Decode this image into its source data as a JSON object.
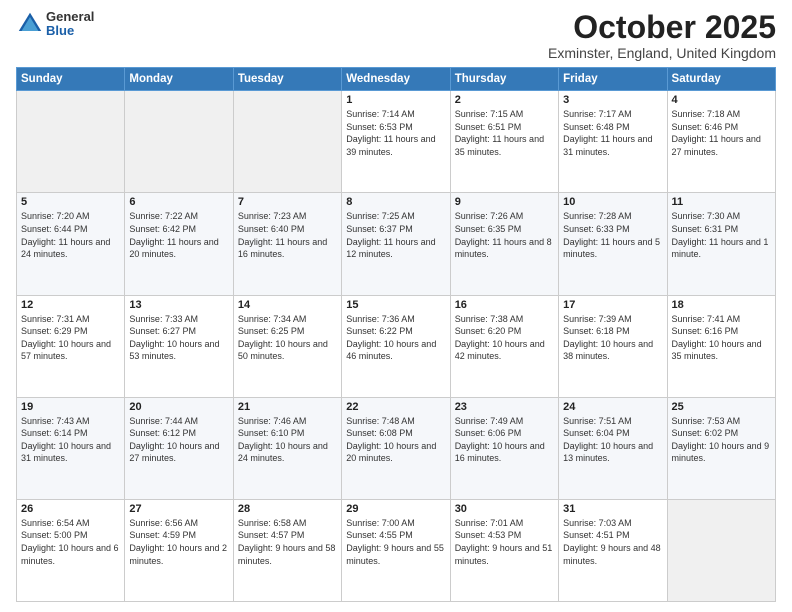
{
  "header": {
    "logo": {
      "general": "General",
      "blue": "Blue"
    },
    "title": "October 2025",
    "subtitle": "Exminster, England, United Kingdom"
  },
  "calendar": {
    "days_of_week": [
      "Sunday",
      "Monday",
      "Tuesday",
      "Wednesday",
      "Thursday",
      "Friday",
      "Saturday"
    ],
    "weeks": [
      [
        {
          "day": "",
          "data": ""
        },
        {
          "day": "",
          "data": ""
        },
        {
          "day": "",
          "data": ""
        },
        {
          "day": "1",
          "data": "Sunrise: 7:14 AM\nSunset: 6:53 PM\nDaylight: 11 hours and 39 minutes."
        },
        {
          "day": "2",
          "data": "Sunrise: 7:15 AM\nSunset: 6:51 PM\nDaylight: 11 hours and 35 minutes."
        },
        {
          "day": "3",
          "data": "Sunrise: 7:17 AM\nSunset: 6:48 PM\nDaylight: 11 hours and 31 minutes."
        },
        {
          "day": "4",
          "data": "Sunrise: 7:18 AM\nSunset: 6:46 PM\nDaylight: 11 hours and 27 minutes."
        }
      ],
      [
        {
          "day": "5",
          "data": "Sunrise: 7:20 AM\nSunset: 6:44 PM\nDaylight: 11 hours and 24 minutes."
        },
        {
          "day": "6",
          "data": "Sunrise: 7:22 AM\nSunset: 6:42 PM\nDaylight: 11 hours and 20 minutes."
        },
        {
          "day": "7",
          "data": "Sunrise: 7:23 AM\nSunset: 6:40 PM\nDaylight: 11 hours and 16 minutes."
        },
        {
          "day": "8",
          "data": "Sunrise: 7:25 AM\nSunset: 6:37 PM\nDaylight: 11 hours and 12 minutes."
        },
        {
          "day": "9",
          "data": "Sunrise: 7:26 AM\nSunset: 6:35 PM\nDaylight: 11 hours and 8 minutes."
        },
        {
          "day": "10",
          "data": "Sunrise: 7:28 AM\nSunset: 6:33 PM\nDaylight: 11 hours and 5 minutes."
        },
        {
          "day": "11",
          "data": "Sunrise: 7:30 AM\nSunset: 6:31 PM\nDaylight: 11 hours and 1 minute."
        }
      ],
      [
        {
          "day": "12",
          "data": "Sunrise: 7:31 AM\nSunset: 6:29 PM\nDaylight: 10 hours and 57 minutes."
        },
        {
          "day": "13",
          "data": "Sunrise: 7:33 AM\nSunset: 6:27 PM\nDaylight: 10 hours and 53 minutes."
        },
        {
          "day": "14",
          "data": "Sunrise: 7:34 AM\nSunset: 6:25 PM\nDaylight: 10 hours and 50 minutes."
        },
        {
          "day": "15",
          "data": "Sunrise: 7:36 AM\nSunset: 6:22 PM\nDaylight: 10 hours and 46 minutes."
        },
        {
          "day": "16",
          "data": "Sunrise: 7:38 AM\nSunset: 6:20 PM\nDaylight: 10 hours and 42 minutes."
        },
        {
          "day": "17",
          "data": "Sunrise: 7:39 AM\nSunset: 6:18 PM\nDaylight: 10 hours and 38 minutes."
        },
        {
          "day": "18",
          "data": "Sunrise: 7:41 AM\nSunset: 6:16 PM\nDaylight: 10 hours and 35 minutes."
        }
      ],
      [
        {
          "day": "19",
          "data": "Sunrise: 7:43 AM\nSunset: 6:14 PM\nDaylight: 10 hours and 31 minutes."
        },
        {
          "day": "20",
          "data": "Sunrise: 7:44 AM\nSunset: 6:12 PM\nDaylight: 10 hours and 27 minutes."
        },
        {
          "day": "21",
          "data": "Sunrise: 7:46 AM\nSunset: 6:10 PM\nDaylight: 10 hours and 24 minutes."
        },
        {
          "day": "22",
          "data": "Sunrise: 7:48 AM\nSunset: 6:08 PM\nDaylight: 10 hours and 20 minutes."
        },
        {
          "day": "23",
          "data": "Sunrise: 7:49 AM\nSunset: 6:06 PM\nDaylight: 10 hours and 16 minutes."
        },
        {
          "day": "24",
          "data": "Sunrise: 7:51 AM\nSunset: 6:04 PM\nDaylight: 10 hours and 13 minutes."
        },
        {
          "day": "25",
          "data": "Sunrise: 7:53 AM\nSunset: 6:02 PM\nDaylight: 10 hours and 9 minutes."
        }
      ],
      [
        {
          "day": "26",
          "data": "Sunrise: 6:54 AM\nSunset: 5:00 PM\nDaylight: 10 hours and 6 minutes."
        },
        {
          "day": "27",
          "data": "Sunrise: 6:56 AM\nSunset: 4:59 PM\nDaylight: 10 hours and 2 minutes."
        },
        {
          "day": "28",
          "data": "Sunrise: 6:58 AM\nSunset: 4:57 PM\nDaylight: 9 hours and 58 minutes."
        },
        {
          "day": "29",
          "data": "Sunrise: 7:00 AM\nSunset: 4:55 PM\nDaylight: 9 hours and 55 minutes."
        },
        {
          "day": "30",
          "data": "Sunrise: 7:01 AM\nSunset: 4:53 PM\nDaylight: 9 hours and 51 minutes."
        },
        {
          "day": "31",
          "data": "Sunrise: 7:03 AM\nSunset: 4:51 PM\nDaylight: 9 hours and 48 minutes."
        },
        {
          "day": "",
          "data": ""
        }
      ]
    ]
  }
}
